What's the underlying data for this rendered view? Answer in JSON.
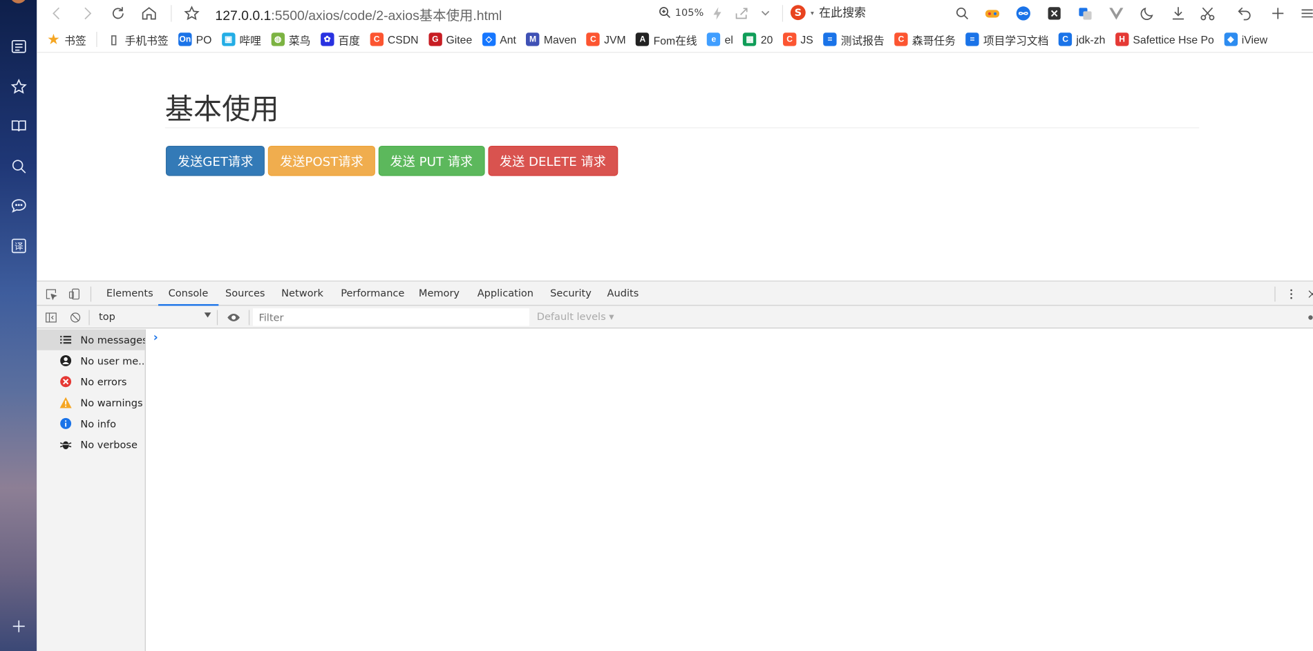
{
  "browser": {
    "url_host": "127.0.0.1",
    "url_path": ":5500/axios/code/2-axios基本使用.html",
    "zoom": "105%",
    "search_engine_label": "在此搜索"
  },
  "bookmarks": [
    {
      "label": "书签",
      "color": "#f5a623",
      "icon": "star-icon"
    },
    {
      "label": "手机书签",
      "color": "#666666",
      "icon": "phone-icon"
    },
    {
      "label": "PO",
      "color": "#1a73e8",
      "icon": "on-icon"
    },
    {
      "label": "哔哩",
      "color": "#23ade5",
      "icon": "bilibili-icon"
    },
    {
      "label": "菜鸟",
      "color": "#7cb342",
      "icon": "runoob-icon"
    },
    {
      "label": "百度",
      "color": "#2932e1",
      "icon": "baidu-icon"
    },
    {
      "label": "CSDN",
      "color": "#fc5531",
      "icon": "csdn-icon"
    },
    {
      "label": "Gitee",
      "color": "#c71d23",
      "icon": "gitee-icon"
    },
    {
      "label": "Ant",
      "color": "#1677ff",
      "icon": "ant-icon"
    },
    {
      "label": "Maven",
      "color": "#3f51b5",
      "icon": "maven-icon"
    },
    {
      "label": "JVM",
      "color": "#fc5531",
      "icon": "csdn-icon"
    },
    {
      "label": "Fom在线",
      "color": "#222222",
      "icon": "angular-icon"
    },
    {
      "label": "el",
      "color": "#409eff",
      "icon": "element-icon"
    },
    {
      "label": "20",
      "color": "#0f9d58",
      "icon": "sheet-icon"
    },
    {
      "label": "JS",
      "color": "#fc5531",
      "icon": "csdn-icon"
    },
    {
      "label": "测试报告",
      "color": "#1a73e8",
      "icon": "doc-icon"
    },
    {
      "label": "森哥任务",
      "color": "#fc5531",
      "icon": "csdn-icon"
    },
    {
      "label": "项目学习文档",
      "color": "#1a73e8",
      "icon": "doc-icon"
    },
    {
      "label": "jdk-zh",
      "color": "#1a73e8",
      "icon": "c-icon"
    },
    {
      "label": "Safettice Hse Po",
      "color": "#e53935",
      "icon": "h-icon"
    },
    {
      "label": "iView",
      "color": "#2d8cf0",
      "icon": "iview-icon"
    }
  ],
  "page": {
    "heading": "基本使用",
    "buttons": [
      {
        "label": "发送GET请求",
        "style": "primary"
      },
      {
        "label": "发送POST请求",
        "style": "warning"
      },
      {
        "label": "发送 PUT 请求",
        "style": "success"
      },
      {
        "label": "发送 DELETE 请求",
        "style": "danger"
      }
    ]
  },
  "devtools": {
    "tabs": [
      "Elements",
      "Console",
      "Sources",
      "Network",
      "Performance",
      "Memory",
      "Application",
      "Security",
      "Audits"
    ],
    "active_tab": "Console",
    "context": "top",
    "filter_placeholder": "Filter",
    "levels_label": "Default levels",
    "sidebar": [
      {
        "label": "No messages",
        "icon": "list-icon",
        "color": "#333333"
      },
      {
        "label": "No user me...",
        "icon": "user-icon",
        "color": "#222222"
      },
      {
        "label": "No errors",
        "icon": "error-icon",
        "color": "#e53935"
      },
      {
        "label": "No warnings",
        "icon": "warning-icon",
        "color": "#f5a623"
      },
      {
        "label": "No info",
        "icon": "info-icon",
        "color": "#1a73e8"
      },
      {
        "label": "No verbose",
        "icon": "bug-icon",
        "color": "#222222"
      }
    ]
  }
}
